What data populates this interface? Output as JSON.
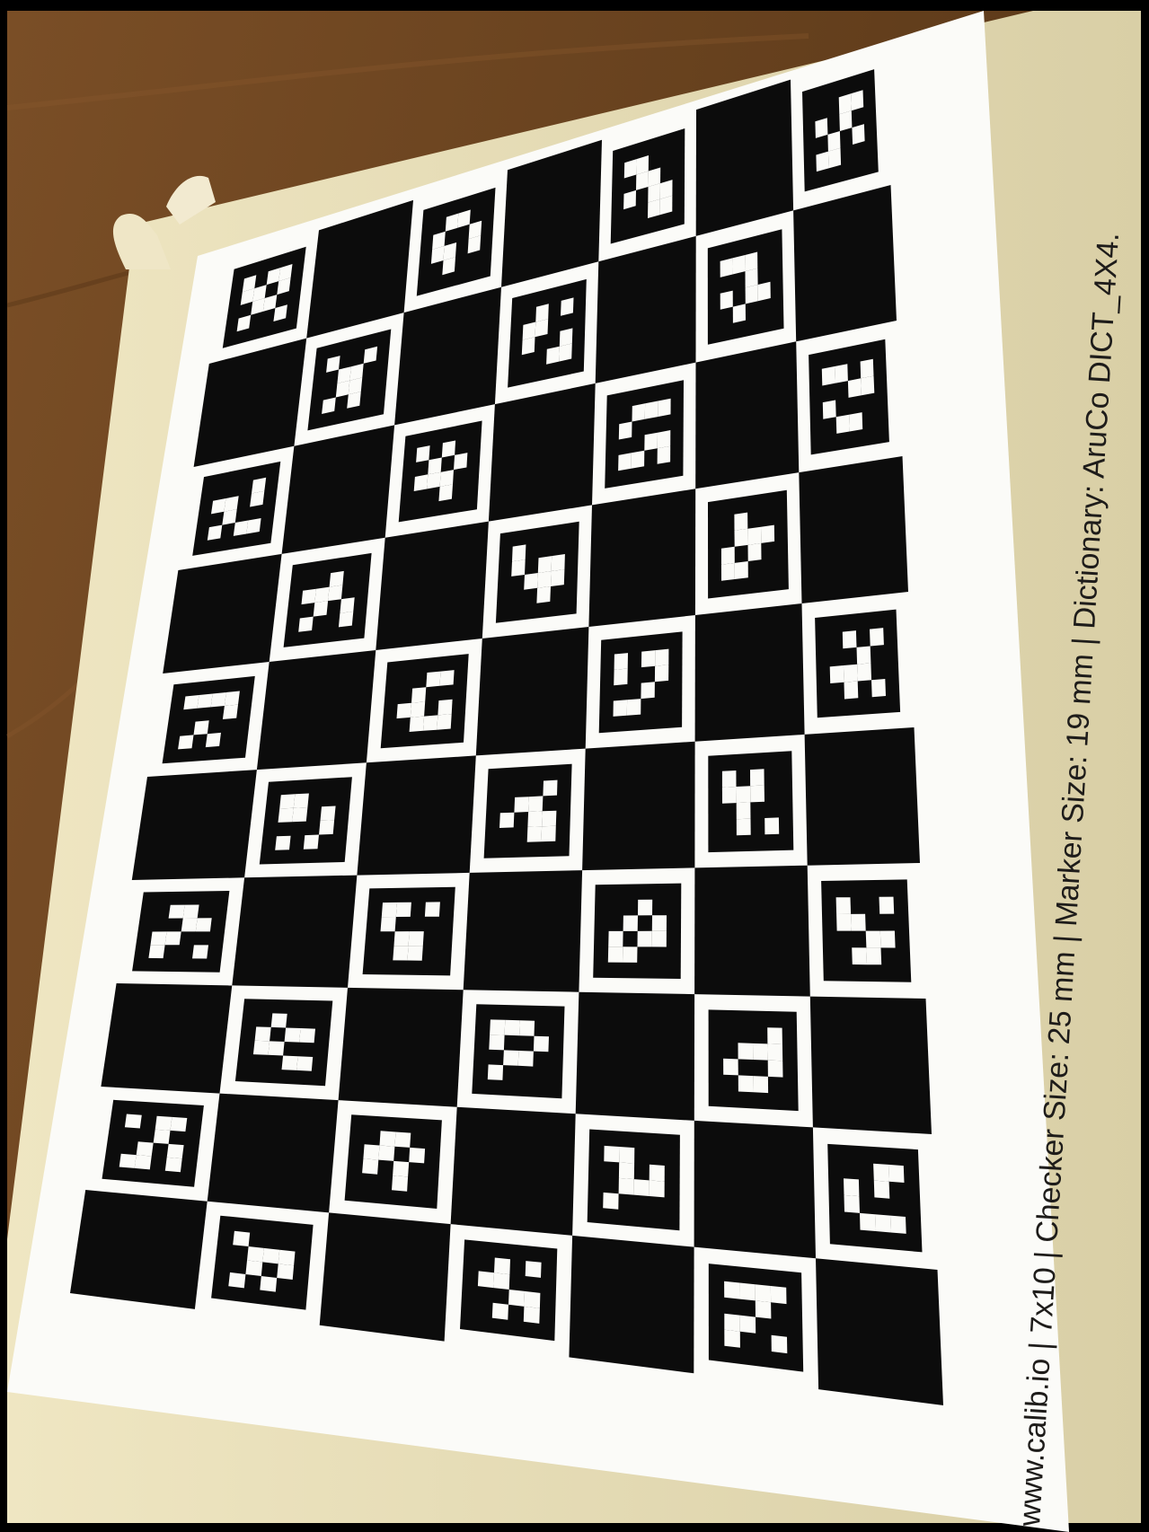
{
  "photo": {
    "subject": "ChArUco calibration board printed on paper, taped to a wooden table",
    "colors": {
      "frame": "#000000",
      "table": "#6b4420",
      "tape": "#e6dcb4",
      "paper": "#fbfbf8",
      "ink": "#0c0c0c"
    }
  },
  "board": {
    "columns": 7,
    "rows": 10,
    "footer_text": "www.calib.io | 7x10 | Checker Size: 25 mm | Marker Size: 19 mm | Dictionary: AruCo DICT_4X4."
  },
  "markers": [
    [
      1,
      0,
      1,
      1,
      1,
      1,
      0,
      1,
      0,
      1,
      1,
      0,
      1,
      0,
      0,
      1
    ],
    [
      0,
      1,
      1,
      0,
      1,
      0,
      0,
      1,
      1,
      1,
      0,
      1,
      0,
      1,
      0,
      0
    ],
    [
      1,
      1,
      0,
      0,
      0,
      1,
      1,
      0,
      1,
      0,
      1,
      1,
      0,
      0,
      1,
      1
    ],
    [
      0,
      0,
      1,
      1,
      1,
      0,
      1,
      0,
      0,
      1,
      0,
      1,
      1,
      1,
      0,
      0
    ],
    [
      1,
      0,
      0,
      1,
      0,
      1,
      1,
      0,
      0,
      1,
      1,
      0,
      1,
      0,
      1,
      0
    ],
    [
      0,
      1,
      0,
      1,
      1,
      1,
      0,
      0,
      1,
      0,
      0,
      1,
      0,
      0,
      1,
      1
    ],
    [
      1,
      1,
      1,
      0,
      0,
      0,
      1,
      0,
      1,
      0,
      1,
      1,
      0,
      1,
      0,
      0
    ],
    [
      0,
      0,
      0,
      1,
      1,
      1,
      0,
      1,
      0,
      1,
      0,
      0,
      1,
      0,
      1,
      1
    ],
    [
      1,
      0,
      1,
      0,
      0,
      1,
      0,
      1,
      1,
      1,
      1,
      0,
      0,
      0,
      1,
      0
    ],
    [
      0,
      1,
      1,
      1,
      1,
      0,
      0,
      0,
      0,
      0,
      1,
      1,
      1,
      1,
      0,
      1
    ],
    [
      1,
      1,
      0,
      1,
      0,
      0,
      1,
      1,
      1,
      0,
      0,
      0,
      0,
      1,
      1,
      0
    ],
    [
      0,
      0,
      1,
      0,
      1,
      1,
      1,
      0,
      0,
      1,
      0,
      1,
      1,
      0,
      0,
      1
    ],
    [
      1,
      0,
      0,
      0,
      1,
      0,
      1,
      1,
      0,
      1,
      1,
      1,
      0,
      0,
      1,
      0
    ],
    [
      0,
      1,
      0,
      0,
      0,
      1,
      1,
      1,
      1,
      0,
      1,
      0,
      1,
      1,
      0,
      0
    ],
    [
      1,
      1,
      1,
      1,
      0,
      0,
      0,
      1,
      0,
      1,
      0,
      0,
      1,
      0,
      1,
      0
    ],
    [
      0,
      0,
      1,
      1,
      0,
      1,
      0,
      0,
      1,
      1,
      0,
      1,
      0,
      1,
      1,
      1
    ],
    [
      1,
      0,
      1,
      1,
      1,
      0,
      0,
      1,
      0,
      0,
      1,
      0,
      1,
      1,
      0,
      0
    ],
    [
      0,
      1,
      0,
      1,
      0,
      0,
      1,
      0,
      1,
      1,
      1,
      0,
      0,
      1,
      0,
      1
    ],
    [
      1,
      1,
      0,
      0,
      1,
      1,
      0,
      1,
      0,
      0,
      0,
      1,
      1,
      0,
      1,
      0
    ],
    [
      0,
      0,
      0,
      1,
      0,
      1,
      1,
      0,
      1,
      0,
      1,
      1,
      0,
      0,
      1,
      1
    ],
    [
      1,
      0,
      1,
      0,
      1,
      1,
      1,
      0,
      0,
      1,
      0,
      0,
      0,
      1,
      0,
      1
    ],
    [
      0,
      1,
      1,
      0,
      0,
      0,
      1,
      1,
      1,
      1,
      0,
      0,
      1,
      0,
      0,
      1
    ],
    [
      1,
      1,
      0,
      1,
      1,
      0,
      0,
      0,
      0,
      1,
      1,
      0,
      0,
      1,
      1,
      0
    ],
    [
      0,
      0,
      1,
      0,
      0,
      1,
      0,
      1,
      1,
      0,
      1,
      1,
      1,
      1,
      0,
      0
    ],
    [
      1,
      0,
      0,
      1,
      1,
      1,
      0,
      0,
      0,
      0,
      1,
      1,
      0,
      1,
      1,
      0
    ],
    [
      0,
      1,
      0,
      0,
      1,
      0,
      1,
      1,
      1,
      1,
      0,
      0,
      0,
      0,
      1,
      1
    ],
    [
      1,
      1,
      1,
      0,
      1,
      0,
      0,
      1,
      0,
      1,
      1,
      0,
      1,
      0,
      0,
      0
    ],
    [
      0,
      0,
      0,
      1,
      0,
      1,
      1,
      1,
      1,
      0,
      0,
      1,
      0,
      1,
      1,
      0
    ],
    [
      1,
      0,
      1,
      1,
      0,
      0,
      1,
      0,
      0,
      1,
      0,
      1,
      1,
      1,
      0,
      1
    ],
    [
      0,
      1,
      1,
      0,
      1,
      1,
      0,
      1,
      1,
      0,
      1,
      0,
      0,
      0,
      1,
      0
    ],
    [
      1,
      1,
      0,
      0,
      0,
      1,
      0,
      1,
      0,
      1,
      1,
      1,
      1,
      0,
      0,
      0
    ],
    [
      0,
      0,
      1,
      1,
      1,
      0,
      1,
      0,
      1,
      0,
      0,
      0,
      0,
      1,
      1,
      1
    ],
    [
      1,
      0,
      0,
      0,
      0,
      1,
      1,
      1,
      0,
      1,
      0,
      1,
      1,
      0,
      1,
      0
    ],
    [
      0,
      1,
      0,
      1,
      1,
      1,
      0,
      0,
      0,
      0,
      1,
      1,
      0,
      1,
      0,
      1
    ],
    [
      1,
      1,
      1,
      1,
      0,
      0,
      1,
      0,
      1,
      1,
      0,
      0,
      1,
      0,
      0,
      1
    ]
  ]
}
